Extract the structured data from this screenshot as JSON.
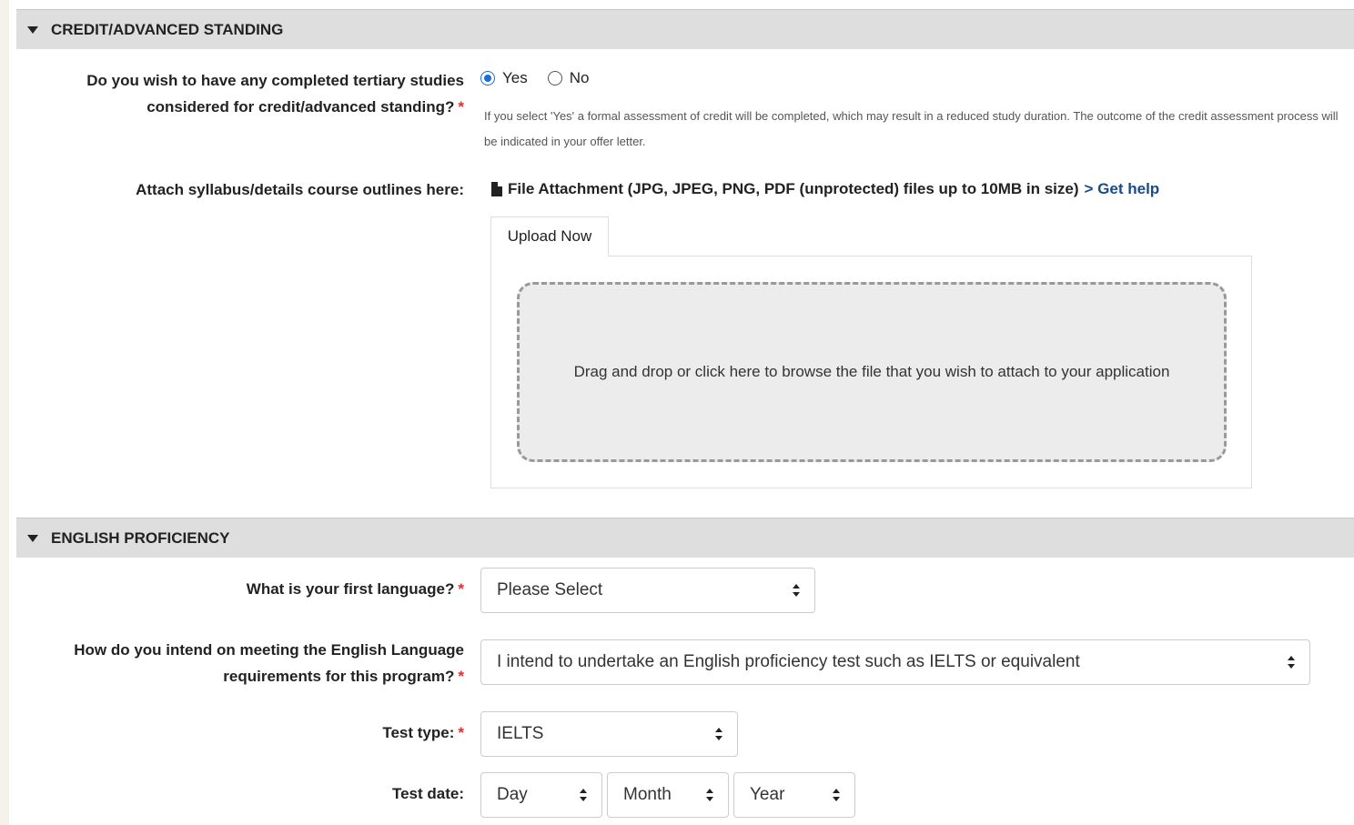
{
  "credit_section": {
    "title": "CREDIT/ADVANCED STANDING",
    "question_line1": "Do you wish to have any completed tertiary studies",
    "question_line2": "considered for credit/advanced standing?",
    "required_mark": "*",
    "options": [
      {
        "label": "Yes",
        "checked": true
      },
      {
        "label": "No",
        "checked": false
      }
    ],
    "help_text": "If you select 'Yes' a formal assessment of credit will be completed, which may result in a reduced study duration. The outcome of the credit assessment process will be indicated in your offer letter.",
    "attach_label": "Attach syllabus/details course outlines here:",
    "attachment_text": "File Attachment (JPG, JPEG, PNG, PDF (unprotected) files up to 10MB in size)",
    "help_link": "> Get help",
    "upload_tab": "Upload Now",
    "dropzone_text": "Drag and drop or click here to browse the file that you wish to attach to your application"
  },
  "english_section": {
    "title": "ENGLISH PROFICIENCY",
    "first_language_label": "What is your first language?",
    "first_language_value": "Please Select",
    "requirements_label_line1": "How do you intend on meeting the English Language",
    "requirements_label_line2": "requirements for this program?",
    "requirements_value": "I intend to undertake an English proficiency test such as IELTS or equivalent",
    "test_type_label": "Test type:",
    "test_type_value": "IELTS",
    "test_date_label": "Test date:",
    "test_date_day": "Day",
    "test_date_month": "Month",
    "test_date_year": "Year",
    "required_mark": "*"
  },
  "colors": {
    "required": "#d9342b",
    "radio_checked": "#1a6fd8",
    "link": "#1a4a8a",
    "section_header_bg": "#dedede"
  }
}
